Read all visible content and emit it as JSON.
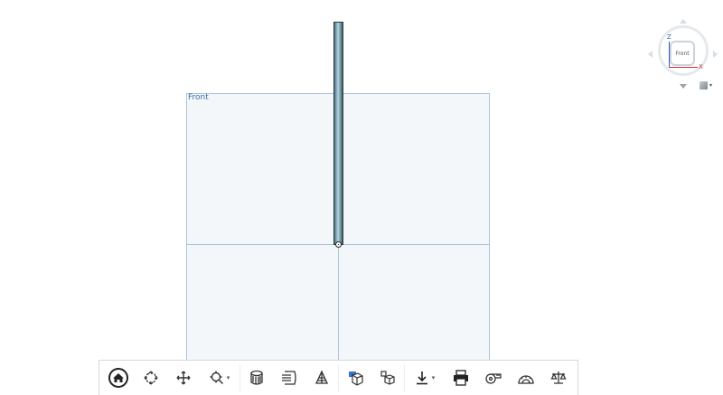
{
  "view": {
    "plane_label": "Front"
  },
  "viewcube": {
    "face_label": "Front",
    "axis_z": "Z",
    "axis_x": "X"
  },
  "toolbar": {
    "buttons": [
      {
        "name": "home",
        "icon": "home-icon"
      },
      {
        "name": "orbit",
        "icon": "orbit-icon"
      },
      {
        "name": "pan",
        "icon": "pan-icon"
      },
      {
        "name": "zoom",
        "icon": "zoom-icon",
        "dropdown": true
      },
      {
        "name": "display-style",
        "icon": "display-style-icon"
      },
      {
        "name": "section",
        "icon": "section-icon"
      },
      {
        "name": "exploded-view",
        "icon": "explode-icon"
      },
      {
        "name": "view-cube-toggle",
        "icon": "view-cube-icon"
      },
      {
        "name": "model-browser",
        "icon": "model-browser-icon"
      },
      {
        "name": "download",
        "icon": "download-icon",
        "dropdown": true
      },
      {
        "name": "print",
        "icon": "print-icon"
      },
      {
        "name": "measure",
        "icon": "tape-measure-icon"
      },
      {
        "name": "protractor",
        "icon": "protractor-icon"
      },
      {
        "name": "mass-properties",
        "icon": "scale-icon"
      }
    ]
  }
}
